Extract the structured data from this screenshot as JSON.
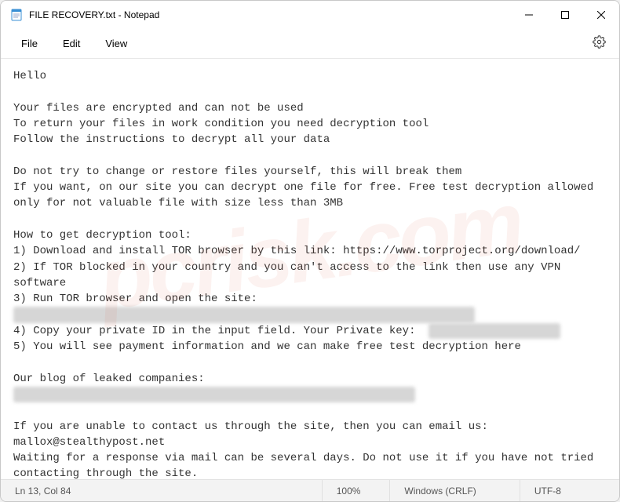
{
  "window": {
    "title": "FILE RECOVERY.txt - Notepad"
  },
  "menu": {
    "file": "File",
    "edit": "Edit",
    "view": "View"
  },
  "content": {
    "l1": "Hello",
    "l2": "Your files are encrypted and can not be used",
    "l3": "To return your files in work condition you need decryption tool",
    "l4": "Follow the instructions to decrypt all your data",
    "l5": "Do not try to change or restore files yourself, this will break them",
    "l6": "If you want, on our site you can decrypt one file for free. Free test decryption allowed only for not valuable file with size less than 3MB",
    "l7": "How to get decryption tool:",
    "l8": "1) Download and install TOR browser by this link: https://www.torproject.org/download/",
    "l9": "2) If TOR blocked in your country and you can't access to the link then use any VPN software",
    "l10": "3) Run TOR browser and open the site:",
    "l11": "4) Copy your private ID in the input field. Your Private key:  ",
    "l12": "5) You will see payment information and we can make free test decryption here",
    "l13": "Our blog of leaked companies:",
    "l14": "If you are unable to contact us through the site, then you can email us: mallox@stealthypost.net",
    "l15": "Waiting for a response via mail can be several days. Do not use it if you have not tried contacting through the site."
  },
  "status": {
    "position": "Ln 13, Col 84",
    "zoom": "100%",
    "lineend": "Windows (CRLF)",
    "encoding": "UTF-8"
  },
  "watermark": "pcrisk.com"
}
